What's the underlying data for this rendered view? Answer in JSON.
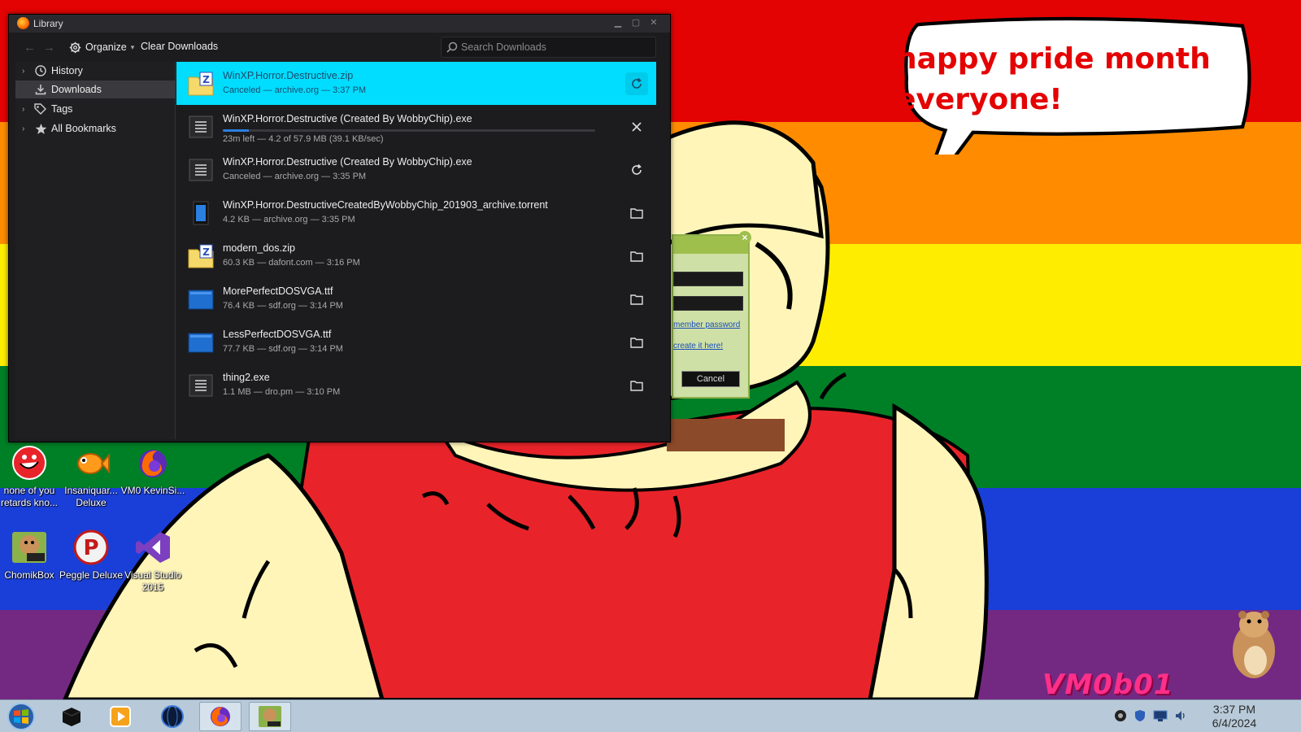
{
  "colors": {
    "selection": "#00ddff",
    "window_bg": "#1c1c1e",
    "progress": "#2a7fe0",
    "flag": [
      "#e40303",
      "#ff8c00",
      "#ffed00",
      "#008026",
      "#1a3fd8",
      "#732982"
    ]
  },
  "wallpaper": {
    "speech": "happy pride month everyone!",
    "signature": "VM0b01"
  },
  "desktop_icons": [
    {
      "label": "none of you retards kno...",
      "icon": "red-character-icon"
    },
    {
      "label": "Insaniquar... Deluxe",
      "icon": "goldfish-icon"
    },
    {
      "label": "VM0 KevinSi...",
      "icon": "firefox-icon"
    },
    {
      "label": "ChomikBox",
      "icon": "hamster-box-icon"
    },
    {
      "label": "Peggle Deluxe",
      "icon": "peggle-icon"
    },
    {
      "label": "Visual Studio 2015",
      "icon": "visual-studio-icon"
    }
  ],
  "bg_dialog": {
    "remember_link": "member password",
    "create_link": "create it here!",
    "cancel": "Cancel"
  },
  "library": {
    "title": "Library",
    "toolbar": {
      "organize": "Organize",
      "clear_downloads": "Clear Downloads",
      "search_placeholder": "Search Downloads"
    },
    "sidebar": [
      {
        "label": "History",
        "icon": "clock-icon",
        "expandable": true
      },
      {
        "label": "Downloads",
        "icon": "download-icon",
        "selected": true
      },
      {
        "label": "Tags",
        "icon": "tag-icon",
        "expandable": true
      },
      {
        "label": "All Bookmarks",
        "icon": "star-icon",
        "expandable": true
      }
    ],
    "downloads": [
      {
        "name": "WinXP.Horror.Destructive.zip",
        "status": "Canceled — archive.org — 3:37 PM",
        "icon": "zip-file-icon",
        "action": "retry-icon",
        "selected": true
      },
      {
        "name": "WinXP.Horror.Destructive (Created By WobbyChip).exe",
        "status": "23m left — 4.2 of 57.9 MB (39.1 KB/sec)",
        "icon": "exe-file-icon",
        "action": "cancel-icon",
        "progress": 0.07
      },
      {
        "name": "WinXP.Horror.Destructive (Created By WobbyChip).exe",
        "status": "Canceled — archive.org — 3:35 PM",
        "icon": "exe-file-icon",
        "action": "retry-icon"
      },
      {
        "name": "WinXP.Horror.DestructiveCreatedByWobbyChip_201903_archive.torrent",
        "status": "4.2 KB — archive.org — 3:35 PM",
        "icon": "torrent-file-icon",
        "action": "folder-icon"
      },
      {
        "name": "modern_dos.zip",
        "status": "60.3 KB — dafont.com — 3:16 PM",
        "icon": "zip-file-icon",
        "action": "folder-icon"
      },
      {
        "name": "MorePerfectDOSVGA.ttf",
        "status": "76.4 KB — sdf.org — 3:14 PM",
        "icon": "font-file-icon",
        "action": "folder-icon"
      },
      {
        "name": "LessPerfectDOSVGA.ttf",
        "status": "77.7 KB — sdf.org — 3:14 PM",
        "icon": "font-file-icon",
        "action": "folder-icon"
      },
      {
        "name": "thing2.exe",
        "status": "1.1 MB — dro.pm — 3:10 PM",
        "icon": "exe-file-icon",
        "action": "folder-icon"
      }
    ]
  },
  "taskbar": {
    "buttons": [
      {
        "icon": "start-orb-icon"
      },
      {
        "icon": "black-cube-icon"
      },
      {
        "icon": "media-player-icon"
      },
      {
        "icon": "globe-icon"
      },
      {
        "icon": "firefox-icon",
        "active": true
      },
      {
        "icon": "chomikbox-icon",
        "active": true
      }
    ],
    "time": "3:37 PM",
    "date": "6/4/2024"
  }
}
